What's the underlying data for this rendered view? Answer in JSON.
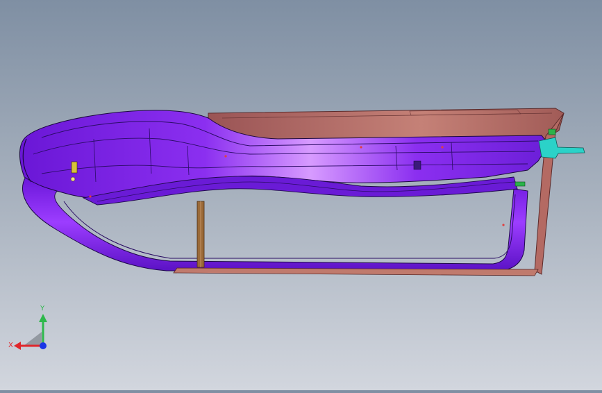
{
  "viewport": {
    "background_top": "#7f8fa3",
    "background_bottom": "#d2d6de",
    "model": {
      "part_colors": {
        "body": "#7a22e0",
        "highlight": "#e7a8ff",
        "outer_panel": "#b46a63",
        "seal_strip": "#8a5a2a",
        "hinge_bracket": "#2bd2c8",
        "clip": "#2bb34a"
      }
    }
  },
  "triad": {
    "x_label": "X",
    "y_label": "Y",
    "x_color": "#e0262b",
    "y_color": "#2eb84b",
    "z_color": "#1a36e6"
  }
}
